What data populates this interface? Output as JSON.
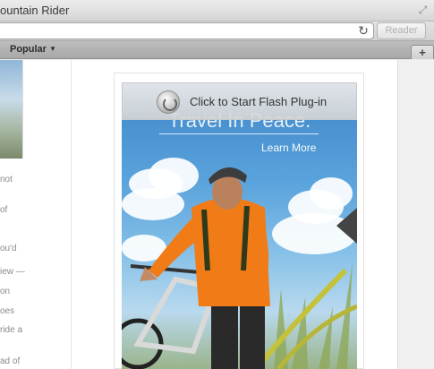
{
  "window": {
    "title": "ountain Rider"
  },
  "toolbar": {
    "reader_label": "Reader"
  },
  "bookmarks": {
    "popular_label": "Popular",
    "new_tab_label": "+"
  },
  "sidebar": {
    "snippets": [
      "not",
      "of",
      "ou'd",
      "iew —",
      "on",
      "oes",
      "ride a",
      "ad of"
    ]
  },
  "ad": {
    "flash_prompt": "Click to Start Flash Plug-in",
    "headline": "Travel In Peace.",
    "cta": "Learn More"
  },
  "icons": {
    "expand": "expand-icon",
    "reload": "reload-icon",
    "caret": "chevron-down-icon",
    "flash": "flash-plugin-icon"
  }
}
